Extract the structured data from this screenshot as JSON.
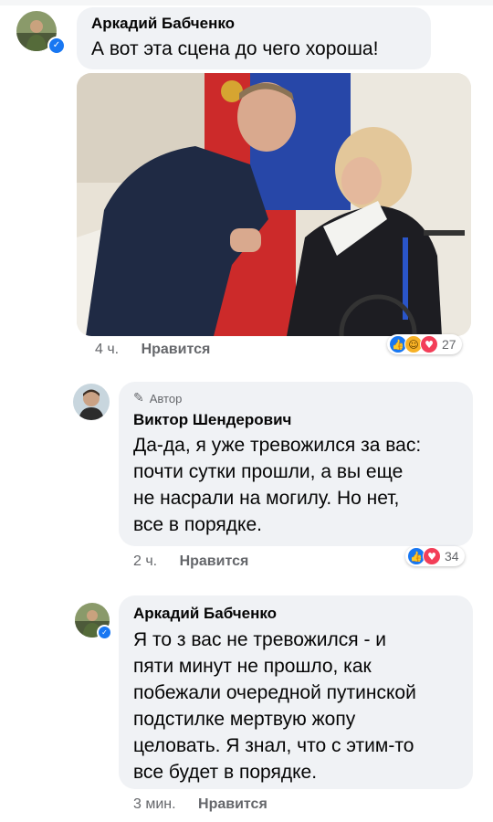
{
  "comments": [
    {
      "author": "Аркадий Бабченко",
      "text": "А вот эта сцена до чего хороша!",
      "time": "4 ч.",
      "like_label": "Нравится",
      "reaction_count": "27"
    },
    {
      "author_badge": "Автор",
      "author": "Виктор Шендерович",
      "lines": [
        "Да-да, я уже тревожился за вас:",
        "почти сутки прошли, а вы еще",
        "не насрали на могилу. Но нет,",
        "все в порядке."
      ],
      "time": "2 ч.",
      "like_label": "Нравится",
      "reaction_count": "34"
    },
    {
      "author": "Аркадий Бабченко",
      "lines": [
        "Я то з вас не тревожился - и",
        "пяти минут не прошло, как",
        "побежали очередной путинской",
        "подстилке мертвую жопу",
        "целовать. Я знал, что с этим-то",
        "все будет в порядке."
      ],
      "time": "3 мин.",
      "like_label": "Нравится"
    }
  ],
  "colors": {
    "bubble": "#f0f2f5",
    "meta": "#65676b",
    "like_blue": "#1877f2",
    "love_red": "#f33e58",
    "haha_yellow": "#f7b125"
  }
}
